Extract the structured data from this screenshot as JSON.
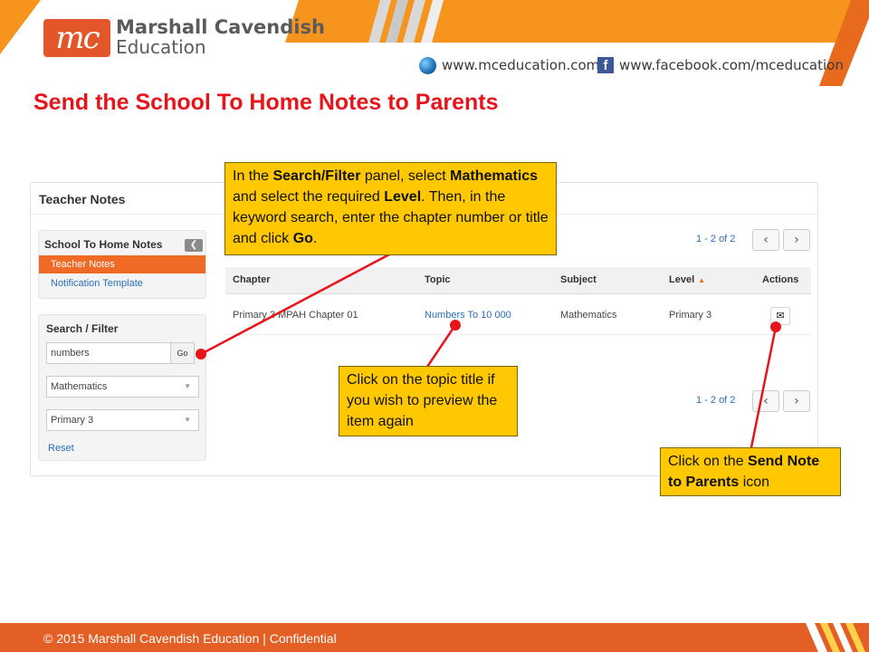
{
  "header": {
    "logo_mark": "mc",
    "brand_line1": "Marshall Cavendish",
    "brand_line2": "Education",
    "website": "www.mceducation.com",
    "facebook": "www.facebook.com/mceducation",
    "icons": [
      "globe-icon",
      "facebook-icon"
    ],
    "accent_color": "#f7941d"
  },
  "slide_title": "Send the School To Home Notes to Parents",
  "app": {
    "title": "Teacher Notes",
    "notes_panel": {
      "heading": "School To Home Notes",
      "collapse_icon": "chevron-left-icon",
      "items": [
        {
          "label": "Teacher Notes",
          "active": true
        },
        {
          "label": "Notification Template",
          "active": false
        }
      ]
    },
    "search_panel": {
      "heading": "Search / Filter",
      "keyword_value": "numbers",
      "go_label": "Go",
      "subject_value": "Mathematics",
      "level_value": "Primary 3",
      "reset_label": "Reset"
    },
    "pager": {
      "text": "1 - 2 of 2",
      "prev_icon": "chevron-left-icon",
      "next_icon": "chevron-right-icon",
      "prev_glyph": "‹",
      "next_glyph": "›"
    },
    "table": {
      "columns": [
        "Chapter",
        "Topic",
        "Subject",
        "Level",
        "Actions"
      ],
      "sorted_column": "Level",
      "rows": [
        {
          "chapter": "Primary 3 MPAH Chapter 01",
          "topic": "Numbers To 10 000",
          "subject": "Mathematics",
          "level": "Primary 3",
          "action_icon": "envelope-icon",
          "action_glyph": "✉"
        }
      ]
    }
  },
  "callouts": {
    "search": {
      "t1": "In the ",
      "b1": "Search/Filter",
      "t2": " panel, select ",
      "b2": "Mathematics",
      "t3": " and select the required ",
      "b3": "Level",
      "t4": ". Then, in the keyword search, enter the chapter number or title and click ",
      "b4": "Go",
      "t5": "."
    },
    "topic": {
      "text": "Click on the topic title if you wish to preview the item again"
    },
    "send": {
      "t1": "Click on the ",
      "b1": "Send Note to Parents",
      "t2": " icon"
    },
    "color": "#ffc800",
    "arrow_color": "#e8141b"
  },
  "footer": {
    "text": "© 2015 Marshall Cavendish Education | Confidential",
    "color": "#e35f25"
  }
}
